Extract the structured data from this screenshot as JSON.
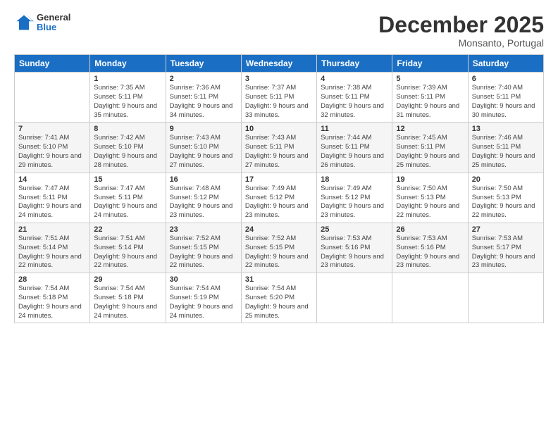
{
  "logo": {
    "general": "General",
    "blue": "Blue"
  },
  "title": "December 2025",
  "subtitle": "Monsanto, Portugal",
  "headers": [
    "Sunday",
    "Monday",
    "Tuesday",
    "Wednesday",
    "Thursday",
    "Friday",
    "Saturday"
  ],
  "weeks": [
    [
      {
        "day": "",
        "sunrise": "",
        "sunset": "",
        "daylight": ""
      },
      {
        "day": "1",
        "sunrise": "Sunrise: 7:35 AM",
        "sunset": "Sunset: 5:11 PM",
        "daylight": "Daylight: 9 hours and 35 minutes."
      },
      {
        "day": "2",
        "sunrise": "Sunrise: 7:36 AM",
        "sunset": "Sunset: 5:11 PM",
        "daylight": "Daylight: 9 hours and 34 minutes."
      },
      {
        "day": "3",
        "sunrise": "Sunrise: 7:37 AM",
        "sunset": "Sunset: 5:11 PM",
        "daylight": "Daylight: 9 hours and 33 minutes."
      },
      {
        "day": "4",
        "sunrise": "Sunrise: 7:38 AM",
        "sunset": "Sunset: 5:11 PM",
        "daylight": "Daylight: 9 hours and 32 minutes."
      },
      {
        "day": "5",
        "sunrise": "Sunrise: 7:39 AM",
        "sunset": "Sunset: 5:11 PM",
        "daylight": "Daylight: 9 hours and 31 minutes."
      },
      {
        "day": "6",
        "sunrise": "Sunrise: 7:40 AM",
        "sunset": "Sunset: 5:11 PM",
        "daylight": "Daylight: 9 hours and 30 minutes."
      }
    ],
    [
      {
        "day": "7",
        "sunrise": "Sunrise: 7:41 AM",
        "sunset": "Sunset: 5:10 PM",
        "daylight": "Daylight: 9 hours and 29 minutes."
      },
      {
        "day": "8",
        "sunrise": "Sunrise: 7:42 AM",
        "sunset": "Sunset: 5:10 PM",
        "daylight": "Daylight: 9 hours and 28 minutes."
      },
      {
        "day": "9",
        "sunrise": "Sunrise: 7:43 AM",
        "sunset": "Sunset: 5:10 PM",
        "daylight": "Daylight: 9 hours and 27 minutes."
      },
      {
        "day": "10",
        "sunrise": "Sunrise: 7:43 AM",
        "sunset": "Sunset: 5:11 PM",
        "daylight": "Daylight: 9 hours and 27 minutes."
      },
      {
        "day": "11",
        "sunrise": "Sunrise: 7:44 AM",
        "sunset": "Sunset: 5:11 PM",
        "daylight": "Daylight: 9 hours and 26 minutes."
      },
      {
        "day": "12",
        "sunrise": "Sunrise: 7:45 AM",
        "sunset": "Sunset: 5:11 PM",
        "daylight": "Daylight: 9 hours and 25 minutes."
      },
      {
        "day": "13",
        "sunrise": "Sunrise: 7:46 AM",
        "sunset": "Sunset: 5:11 PM",
        "daylight": "Daylight: 9 hours and 25 minutes."
      }
    ],
    [
      {
        "day": "14",
        "sunrise": "Sunrise: 7:47 AM",
        "sunset": "Sunset: 5:11 PM",
        "daylight": "Daylight: 9 hours and 24 minutes."
      },
      {
        "day": "15",
        "sunrise": "Sunrise: 7:47 AM",
        "sunset": "Sunset: 5:11 PM",
        "daylight": "Daylight: 9 hours and 24 minutes."
      },
      {
        "day": "16",
        "sunrise": "Sunrise: 7:48 AM",
        "sunset": "Sunset: 5:12 PM",
        "daylight": "Daylight: 9 hours and 23 minutes."
      },
      {
        "day": "17",
        "sunrise": "Sunrise: 7:49 AM",
        "sunset": "Sunset: 5:12 PM",
        "daylight": "Daylight: 9 hours and 23 minutes."
      },
      {
        "day": "18",
        "sunrise": "Sunrise: 7:49 AM",
        "sunset": "Sunset: 5:12 PM",
        "daylight": "Daylight: 9 hours and 23 minutes."
      },
      {
        "day": "19",
        "sunrise": "Sunrise: 7:50 AM",
        "sunset": "Sunset: 5:13 PM",
        "daylight": "Daylight: 9 hours and 22 minutes."
      },
      {
        "day": "20",
        "sunrise": "Sunrise: 7:50 AM",
        "sunset": "Sunset: 5:13 PM",
        "daylight": "Daylight: 9 hours and 22 minutes."
      }
    ],
    [
      {
        "day": "21",
        "sunrise": "Sunrise: 7:51 AM",
        "sunset": "Sunset: 5:14 PM",
        "daylight": "Daylight: 9 hours and 22 minutes."
      },
      {
        "day": "22",
        "sunrise": "Sunrise: 7:51 AM",
        "sunset": "Sunset: 5:14 PM",
        "daylight": "Daylight: 9 hours and 22 minutes."
      },
      {
        "day": "23",
        "sunrise": "Sunrise: 7:52 AM",
        "sunset": "Sunset: 5:15 PM",
        "daylight": "Daylight: 9 hours and 22 minutes."
      },
      {
        "day": "24",
        "sunrise": "Sunrise: 7:52 AM",
        "sunset": "Sunset: 5:15 PM",
        "daylight": "Daylight: 9 hours and 22 minutes."
      },
      {
        "day": "25",
        "sunrise": "Sunrise: 7:53 AM",
        "sunset": "Sunset: 5:16 PM",
        "daylight": "Daylight: 9 hours and 23 minutes."
      },
      {
        "day": "26",
        "sunrise": "Sunrise: 7:53 AM",
        "sunset": "Sunset: 5:16 PM",
        "daylight": "Daylight: 9 hours and 23 minutes."
      },
      {
        "day": "27",
        "sunrise": "Sunrise: 7:53 AM",
        "sunset": "Sunset: 5:17 PM",
        "daylight": "Daylight: 9 hours and 23 minutes."
      }
    ],
    [
      {
        "day": "28",
        "sunrise": "Sunrise: 7:54 AM",
        "sunset": "Sunset: 5:18 PM",
        "daylight": "Daylight: 9 hours and 24 minutes."
      },
      {
        "day": "29",
        "sunrise": "Sunrise: 7:54 AM",
        "sunset": "Sunset: 5:18 PM",
        "daylight": "Daylight: 9 hours and 24 minutes."
      },
      {
        "day": "30",
        "sunrise": "Sunrise: 7:54 AM",
        "sunset": "Sunset: 5:19 PM",
        "daylight": "Daylight: 9 hours and 24 minutes."
      },
      {
        "day": "31",
        "sunrise": "Sunrise: 7:54 AM",
        "sunset": "Sunset: 5:20 PM",
        "daylight": "Daylight: 9 hours and 25 minutes."
      },
      {
        "day": "",
        "sunrise": "",
        "sunset": "",
        "daylight": ""
      },
      {
        "day": "",
        "sunrise": "",
        "sunset": "",
        "daylight": ""
      },
      {
        "day": "",
        "sunrise": "",
        "sunset": "",
        "daylight": ""
      }
    ]
  ]
}
